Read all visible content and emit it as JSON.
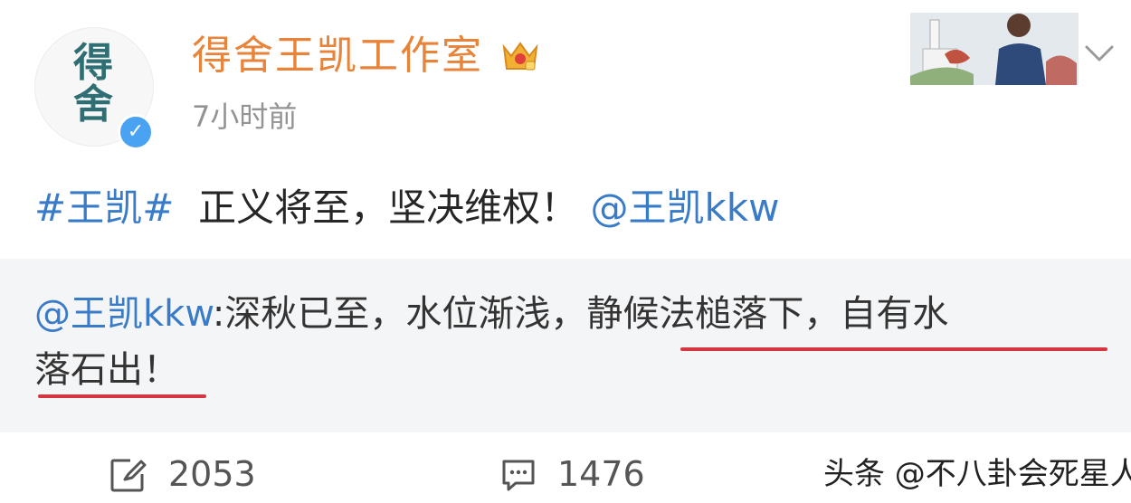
{
  "post": {
    "author": {
      "name": "得舍王凯工作室",
      "avatar_text": "得舍",
      "verified": true,
      "badge_icon": "crown-vip-icon"
    },
    "timestamp": "7小时前",
    "text": {
      "hashtag": "#王凯#",
      "body": "正义将至，坚决维权！",
      "mention": "@王凯kkw"
    },
    "repost": {
      "mention": "@王凯kkw",
      "line1_rest": ":深秋已至，水位渐浅，",
      "line1_highlight": "静候法槌落下，自有水",
      "line2_highlight": "落石出！"
    },
    "actions": {
      "repost_count": "2053",
      "comment_count": "1476"
    }
  },
  "watermark": "头条 @不八卦会死星人",
  "colors": {
    "username": "#e8833a",
    "link": "#3a7bc8",
    "underline": "#d6363f",
    "verified": "#4aa3f2"
  }
}
